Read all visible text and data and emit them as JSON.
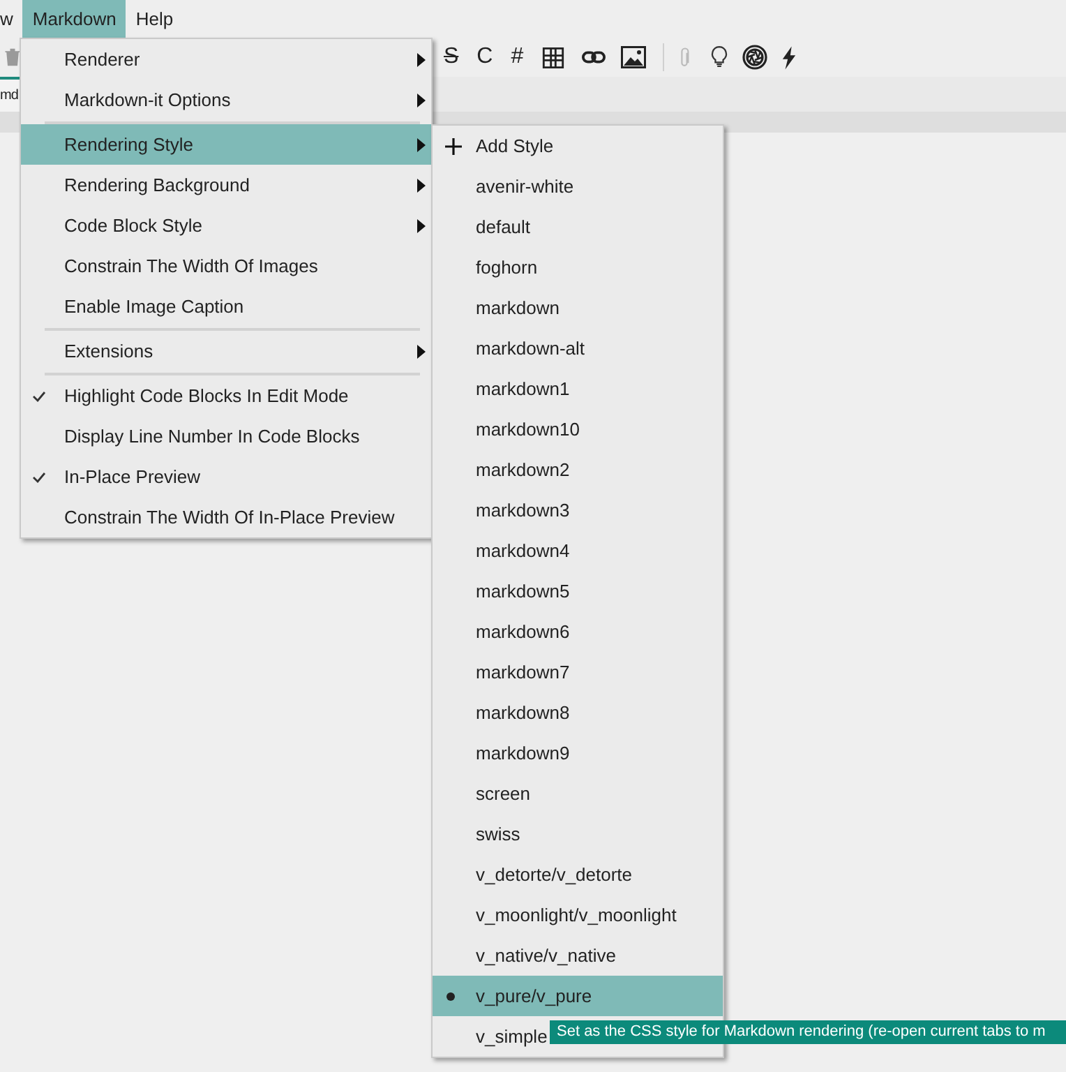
{
  "menubar": [
    {
      "label": "w",
      "selected": false
    },
    {
      "label": "Markdown",
      "selected": true
    },
    {
      "label": "Help",
      "selected": false
    }
  ],
  "toolbar": [
    {
      "kind": "icon",
      "disabled": false
    },
    {
      "kind": "glyph",
      "text": "S",
      "disabled": false
    },
    {
      "kind": "glyph",
      "text": "C",
      "disabled": false
    },
    {
      "kind": "glyph",
      "text": "#",
      "disabled": false
    },
    {
      "kind": "icon",
      "disabled": false
    },
    {
      "kind": "icon",
      "disabled": false
    },
    {
      "kind": "icon",
      "disabled": false
    },
    {
      "kind": "separator"
    },
    {
      "kind": "icon",
      "disabled": true
    },
    {
      "kind": "icon",
      "disabled": false
    },
    {
      "kind": "icon",
      "disabled": false
    },
    {
      "kind": "icon",
      "disabled": false
    }
  ],
  "tab": {
    "label": "md"
  },
  "menu": {
    "groups": [
      [
        {
          "label": "Renderer",
          "kind": "submenu",
          "selected": false
        },
        {
          "label": "Markdown-it Options",
          "kind": "submenu",
          "selected": false
        }
      ],
      [
        {
          "label": "Rendering Style",
          "kind": "submenu",
          "selected": true
        },
        {
          "label": "Rendering Background",
          "kind": "submenu",
          "selected": false
        },
        {
          "label": "Code Block Style",
          "kind": "submenu",
          "selected": false
        },
        {
          "label": "Constrain The Width Of Images",
          "kind": "action",
          "selected": false
        },
        {
          "label": "Enable Image Caption",
          "kind": "action",
          "selected": false
        }
      ],
      [
        {
          "label": "Extensions",
          "kind": "submenu",
          "selected": false
        }
      ],
      [
        {
          "label": "Highlight Code Blocks In Edit Mode",
          "kind": "check",
          "checked": true,
          "selected": false
        },
        {
          "label": "Display Line Number In Code Blocks",
          "kind": "check",
          "checked": false,
          "selected": false
        },
        {
          "label": "In-Place Preview",
          "kind": "check",
          "checked": true,
          "selected": false
        },
        {
          "label": "Constrain The Width Of In-Place Preview",
          "kind": "check",
          "checked": false,
          "selected": false
        }
      ]
    ]
  },
  "submenu": {
    "items": [
      {
        "label": "Add Style",
        "kind": "action",
        "selected": false
      },
      {
        "label": "avenir-white",
        "kind": "radio",
        "checked": false,
        "selected": false
      },
      {
        "label": "default",
        "kind": "radio",
        "checked": false,
        "selected": false
      },
      {
        "label": "foghorn",
        "kind": "radio",
        "checked": false,
        "selected": false
      },
      {
        "label": "markdown",
        "kind": "radio",
        "checked": false,
        "selected": false
      },
      {
        "label": "markdown-alt",
        "kind": "radio",
        "checked": false,
        "selected": false
      },
      {
        "label": "markdown1",
        "kind": "radio",
        "checked": false,
        "selected": false
      },
      {
        "label": "markdown10",
        "kind": "radio",
        "checked": false,
        "selected": false
      },
      {
        "label": "markdown2",
        "kind": "radio",
        "checked": false,
        "selected": false
      },
      {
        "label": "markdown3",
        "kind": "radio",
        "checked": false,
        "selected": false
      },
      {
        "label": "markdown4",
        "kind": "radio",
        "checked": false,
        "selected": false
      },
      {
        "label": "markdown5",
        "kind": "radio",
        "checked": false,
        "selected": false
      },
      {
        "label": "markdown6",
        "kind": "radio",
        "checked": false,
        "selected": false
      },
      {
        "label": "markdown7",
        "kind": "radio",
        "checked": false,
        "selected": false
      },
      {
        "label": "markdown8",
        "kind": "radio",
        "checked": false,
        "selected": false
      },
      {
        "label": "markdown9",
        "kind": "radio",
        "checked": false,
        "selected": false
      },
      {
        "label": "screen",
        "kind": "radio",
        "checked": false,
        "selected": false
      },
      {
        "label": "swiss",
        "kind": "radio",
        "checked": false,
        "selected": false
      },
      {
        "label": "v_detorte/v_detorte",
        "kind": "radio",
        "checked": false,
        "selected": false
      },
      {
        "label": "v_moonlight/v_moonlight",
        "kind": "radio",
        "checked": false,
        "selected": false
      },
      {
        "label": "v_native/v_native",
        "kind": "radio",
        "checked": false,
        "selected": false
      },
      {
        "label": "v_pure/v_pure",
        "kind": "radio",
        "checked": true,
        "selected": true
      },
      {
        "label": "v_simple",
        "kind": "radio",
        "checked": false,
        "selected": false
      }
    ]
  },
  "tooltip": {
    "text": "Set as the CSS style for Markdown rendering (re-open current tabs to m"
  }
}
